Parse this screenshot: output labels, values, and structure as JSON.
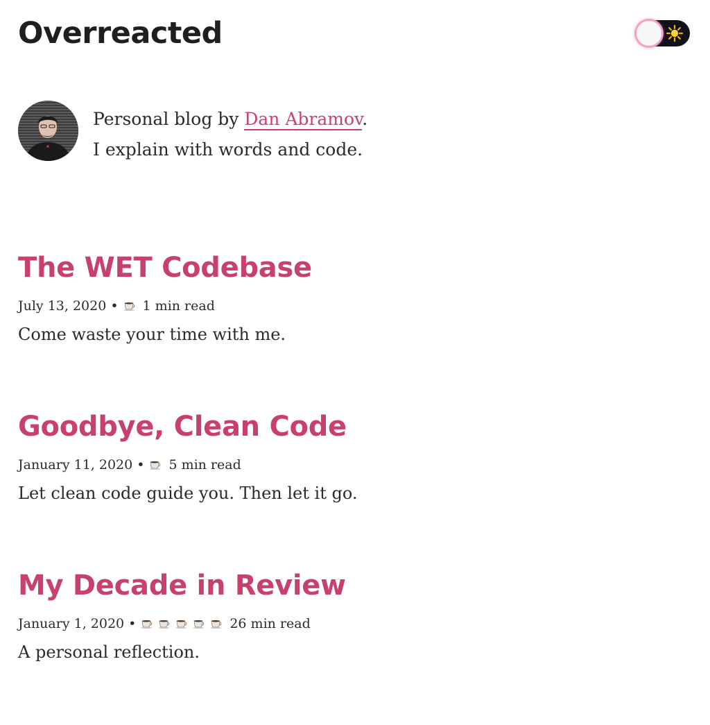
{
  "site": {
    "title": "Overreacted"
  },
  "theme_toggle": {
    "icon": "sun-icon",
    "state": "light",
    "accent": "#f2a2c2",
    "track_color": "#10111a"
  },
  "bio": {
    "prefix": "Personal blog by ",
    "author": "Dan Abramov",
    "suffix": ".",
    "tagline": "I explain with words and code."
  },
  "colors": {
    "accent": "#c84070",
    "text": "#2a2a2a",
    "title": "#1f1f1f"
  },
  "posts": [
    {
      "title": "The WET Codebase",
      "date": "July 13, 2020",
      "separator": "•",
      "read_time": "1 min read",
      "cups": 1,
      "spoiler": "Come waste your time with me."
    },
    {
      "title": "Goodbye, Clean Code",
      "date": "January 11, 2020",
      "separator": "•",
      "read_time": "5 min read",
      "cups": 1,
      "spoiler": "Let clean code guide you. Then let it go."
    },
    {
      "title": "My Decade in Review",
      "date": "January 1, 2020",
      "separator": "•",
      "read_time": "26 min read",
      "cups": 5,
      "spoiler": "A personal reflection."
    }
  ]
}
